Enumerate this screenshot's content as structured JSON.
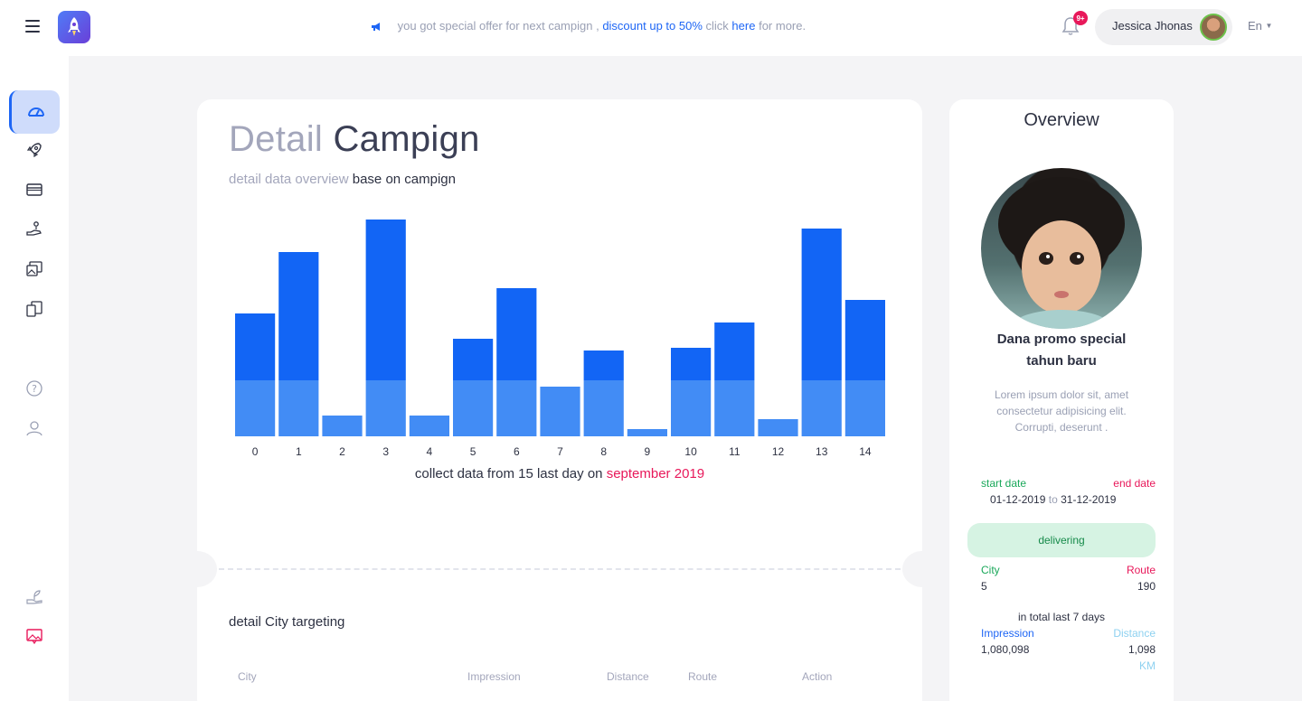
{
  "topbar": {
    "promo_prefix": "you got special offer for next campign ,",
    "promo_discount": "discount up to 50%",
    "promo_click": "click",
    "promo_here": "here",
    "promo_suffix": "for more.",
    "notification_badge": "9+",
    "user_name": "Jessica Jhonas",
    "language": "En"
  },
  "sidebar": {
    "items": [
      {
        "icon": "dashboard-icon",
        "active": true
      },
      {
        "icon": "rocket-icon"
      },
      {
        "icon": "card-icon"
      },
      {
        "icon": "hand-coin-icon"
      },
      {
        "icon": "gallery-icon"
      },
      {
        "icon": "tablet-icon"
      },
      {
        "icon": "help-icon"
      },
      {
        "icon": "user-icon"
      },
      {
        "icon": "plant-icon"
      },
      {
        "icon": "image-message-icon"
      }
    ]
  },
  "main": {
    "title_light": "Detail",
    "title_dark": "Campign",
    "subtitle_light": "detail data overview",
    "subtitle_dark": "base on campign",
    "caption_prefix": "collect data from 15 last day on",
    "caption_highlight": "september 2019",
    "section_title": "detail City targeting",
    "table_headers": [
      "City",
      "Impression",
      "Distance",
      "Route",
      "Action"
    ]
  },
  "chart_data": {
    "type": "bar",
    "categories": [
      "0",
      "1",
      "2",
      "3",
      "4",
      "5",
      "6",
      "7",
      "8",
      "9",
      "10",
      "11",
      "12",
      "13",
      "14"
    ],
    "series": [
      {
        "values": [
          62,
          62,
          23,
          62,
          23,
          62,
          62,
          55,
          62,
          8,
          62,
          62,
          19,
          62,
          62
        ]
      },
      {
        "values": [
          74,
          142,
          0,
          178,
          0,
          46,
          102,
          0,
          33,
          0,
          36,
          64,
          0,
          168,
          89
        ]
      }
    ],
    "stacked": true,
    "colors": [
      "#428cf5",
      "#1265f5"
    ],
    "grid": false,
    "legend": "none",
    "ylim": [
      0,
      240
    ]
  },
  "overview": {
    "title": "Overview",
    "name_line1": "Dana promo special",
    "name_line2": "tahun baru",
    "description": "Lorem ipsum dolor sit, amet consectetur adipisicing elit. Corrupti, deserunt .",
    "start_label": "start date",
    "end_label": "end date",
    "start_date": "01-12-2019",
    "to_word": "to",
    "end_date": "31-12-2019",
    "status": "delivering",
    "city_label": "City",
    "route_label": "Route",
    "city_value": "5",
    "route_value": "190",
    "total_note": "in total last 7 days",
    "impression_label": "Impression",
    "distance_label": "Distance",
    "impression_value": "1,080,098",
    "distance_value": "1,098",
    "distance_unit": "KM"
  }
}
